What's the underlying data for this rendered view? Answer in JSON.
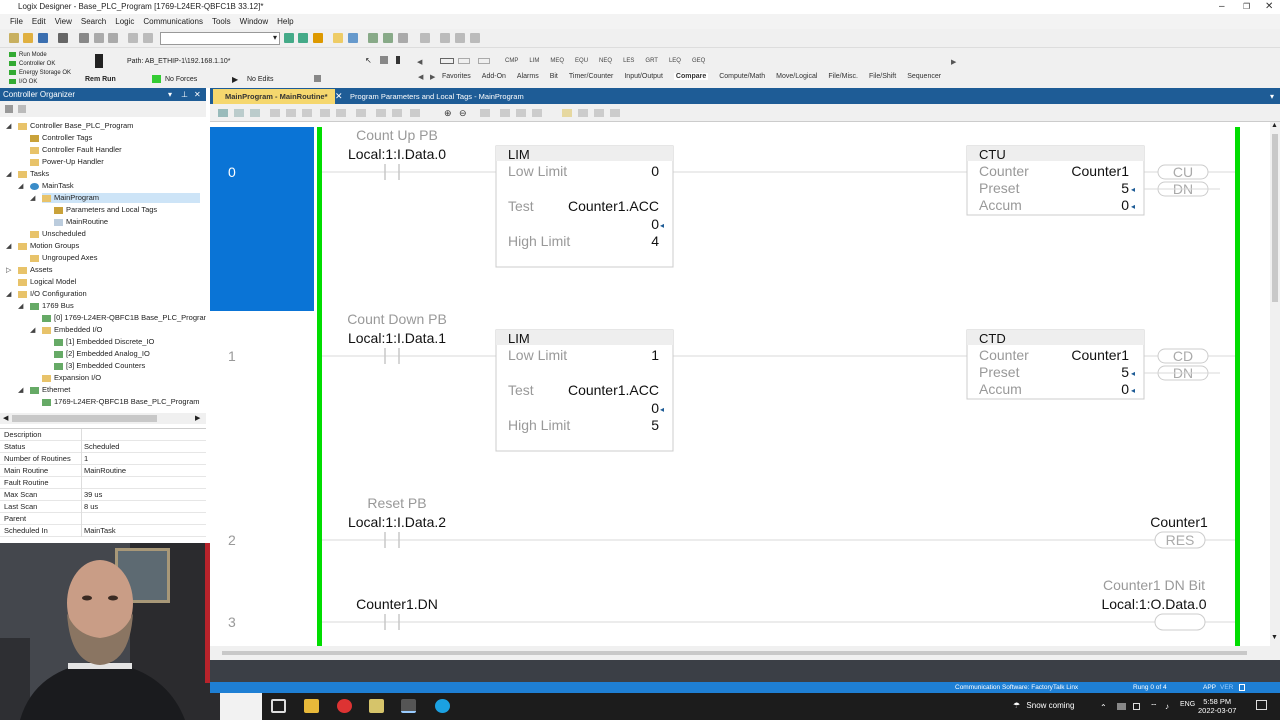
{
  "app": {
    "title": "Logix Designer - Base_PLC_Program [1769-L24ER-QBFC1B 33.12]*"
  },
  "menu": [
    "File",
    "Edit",
    "View",
    "Search",
    "Logic",
    "Communications",
    "Tools",
    "Window",
    "Help"
  ],
  "controller_status": {
    "leds": [
      "Run Mode",
      "Controller OK",
      "Energy Storage OK",
      "I/O OK"
    ],
    "path_label": "Path: AB_ETHIP-1\\192.168.1.10*",
    "mode": "Rem Run",
    "forces": "No Forces",
    "edits": "No Edits"
  },
  "instructions": [
    "CMP",
    "LIM",
    "MEQ",
    "EQU",
    "NEQ",
    "LES",
    "GRT",
    "LEQ",
    "GEQ"
  ],
  "instruction_categories": [
    "Favorites",
    "Add-On",
    "Alarms",
    "Bit",
    "Timer/Counter",
    "Input/Output",
    "Compare",
    "Compute/Math",
    "Move/Logical",
    "File/Misc.",
    "File/Shift",
    "Sequencer"
  ],
  "active_category": "Compare",
  "organizer": {
    "title": "Controller Organizer",
    "tree": [
      {
        "label": "Controller Base_PLC_Program",
        "level": 0,
        "icon": "folder-icon",
        "exp": "◢"
      },
      {
        "label": "Controller Tags",
        "level": 1,
        "icon": "tag-icon",
        "exp": ""
      },
      {
        "label": "Controller Fault Handler",
        "level": 1,
        "icon": "folder-icon",
        "exp": ""
      },
      {
        "label": "Power-Up Handler",
        "level": 1,
        "icon": "folder-icon",
        "exp": ""
      },
      {
        "label": "Tasks",
        "level": 0,
        "icon": "folder-icon",
        "exp": "◢"
      },
      {
        "label": "MainTask",
        "level": 1,
        "icon": "gear-icon",
        "exp": "◢"
      },
      {
        "label": "MainProgram",
        "level": 2,
        "icon": "folder-icon",
        "exp": "◢",
        "selected": true
      },
      {
        "label": "Parameters and Local Tags",
        "level": 3,
        "icon": "tag-icon",
        "exp": ""
      },
      {
        "label": "MainRoutine",
        "level": 3,
        "icon": "doc-icon",
        "exp": ""
      },
      {
        "label": "Unscheduled",
        "level": 1,
        "icon": "folder-icon",
        "exp": ""
      },
      {
        "label": "Motion Groups",
        "level": 0,
        "icon": "folder-icon",
        "exp": "◢"
      },
      {
        "label": "Ungrouped Axes",
        "level": 1,
        "icon": "folder-icon",
        "exp": ""
      },
      {
        "label": "Assets",
        "level": 0,
        "icon": "folder-icon",
        "exp": "▷"
      },
      {
        "label": "Logical Model",
        "level": 0,
        "icon": "folder-icon",
        "exp": ""
      },
      {
        "label": "I/O Configuration",
        "level": 0,
        "icon": "folder-icon",
        "exp": "◢"
      },
      {
        "label": "1769 Bus",
        "level": 1,
        "icon": "chip-icon",
        "exp": "◢"
      },
      {
        "label": "[0] 1769-L24ER-QBFC1B Base_PLC_Program",
        "level": 2,
        "icon": "chip-icon",
        "exp": ""
      },
      {
        "label": "Embedded I/O",
        "level": 2,
        "icon": "folder-icon",
        "exp": "◢"
      },
      {
        "label": "[1] Embedded Discrete_IO",
        "level": 3,
        "icon": "chip-icon",
        "exp": ""
      },
      {
        "label": "[2] Embedded Analog_IO",
        "level": 3,
        "icon": "chip-icon",
        "exp": ""
      },
      {
        "label": "[3] Embedded Counters",
        "level": 3,
        "icon": "chip-icon",
        "exp": ""
      },
      {
        "label": "Expansion I/O",
        "level": 2,
        "icon": "folder-icon",
        "exp": ""
      },
      {
        "label": "Ethernet",
        "level": 1,
        "icon": "chip-icon",
        "exp": "◢"
      },
      {
        "label": "1769-L24ER-QBFC1B Base_PLC_Program",
        "level": 2,
        "icon": "chip-icon",
        "exp": ""
      }
    ],
    "properties": [
      {
        "k": "Description",
        "v": ""
      },
      {
        "k": "Status",
        "v": "Scheduled"
      },
      {
        "k": "Number of Routines",
        "v": "1"
      },
      {
        "k": "Main Routine",
        "v": "MainRoutine"
      },
      {
        "k": "Fault Routine",
        "v": ""
      },
      {
        "k": "Max Scan",
        "v": "39 us"
      },
      {
        "k": "Last Scan",
        "v": "8 us"
      },
      {
        "k": "Parent",
        "v": ""
      },
      {
        "k": "Scheduled In",
        "v": "MainTask"
      }
    ]
  },
  "tabs": {
    "active": "MainProgram - MainRoutine*",
    "second": "Program Parameters and Local Tags - MainProgram"
  },
  "ladder": {
    "rungs": [
      {
        "number": "0",
        "contact": {
          "desc": "Count Up PB",
          "tag": "Local:1:I.Data.0"
        },
        "lim": {
          "title": "LIM",
          "low_label": "Low Limit",
          "low": "0",
          "test_label": "Test",
          "test": "Counter1.ACC",
          "test_val": "0",
          "high_label": "High Limit",
          "high": "4"
        },
        "counter": {
          "title": "CTU",
          "counter_label": "Counter",
          "counter": "Counter1",
          "preset_label": "Preset",
          "preset": "5",
          "accum_label": "Accum",
          "accum": "0",
          "out1": "CU",
          "out2": "DN"
        }
      },
      {
        "number": "1",
        "contact": {
          "desc": "Count Down PB",
          "tag": "Local:1:I.Data.1"
        },
        "lim": {
          "title": "LIM",
          "low_label": "Low Limit",
          "low": "1",
          "test_label": "Test",
          "test": "Counter1.ACC",
          "test_val": "0",
          "high_label": "High Limit",
          "high": "5"
        },
        "counter": {
          "title": "CTD",
          "counter_label": "Counter",
          "counter": "Counter1",
          "preset_label": "Preset",
          "preset": "5",
          "accum_label": "Accum",
          "accum": "0",
          "out1": "CD",
          "out2": "DN"
        }
      },
      {
        "number": "2",
        "contact": {
          "desc": "Reset PB",
          "tag": "Local:1:I.Data.2"
        },
        "output": {
          "tag": "Counter1",
          "label": "RES"
        }
      },
      {
        "number": "3",
        "contact": {
          "desc": "",
          "tag": "Counter1.DN"
        },
        "output": {
          "desc": "Counter1 DN Bit",
          "tag": "Local:1:O.Data.0"
        }
      }
    ]
  },
  "statusbar": {
    "comm": "Communication Software: FactoryTalk Linx",
    "rung": "Rung 0 of 4",
    "app": "APP",
    "ver": "VER"
  },
  "taskbar": {
    "weather": "Snow coming",
    "lang": "ENG",
    "time": "5:58 PM",
    "date": "2022-03-07"
  },
  "colors": {
    "accent": "#1e5c96",
    "rail": "#00dd00",
    "selected_rung": "#0a74d6",
    "tab_active": "#f5d76e",
    "status": "#1e7fd4"
  }
}
